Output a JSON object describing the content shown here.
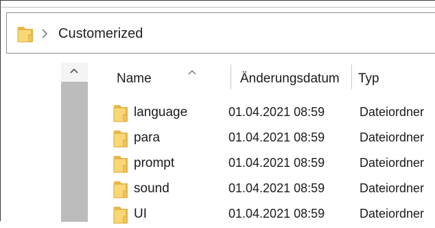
{
  "address_bar": {
    "path": "Customerized",
    "folder_icon": "folder-icon",
    "separator_icon": "chevron-right-icon"
  },
  "columns": {
    "name": "Name",
    "date": "Änderungsdatum",
    "type": "Typ",
    "sort_icon": "sort-ascending-icon"
  },
  "nav_pane": {
    "scroll_icon": "chevron-up-icon"
  },
  "colors": {
    "folder_fill": "#f8d775",
    "folder_tab": "#e8b84a",
    "nav_pane": "#bcbcbc"
  },
  "files": [
    {
      "name": "language",
      "date": "01.04.2021 08:59",
      "type": "Dateiordner"
    },
    {
      "name": "para",
      "date": "01.04.2021 08:59",
      "type": "Dateiordner"
    },
    {
      "name": "prompt",
      "date": "01.04.2021 08:59",
      "type": "Dateiordner"
    },
    {
      "name": "sound",
      "date": "01.04.2021 08:59",
      "type": "Dateiordner"
    },
    {
      "name": "UI",
      "date": "01.04.2021 08:59",
      "type": "Dateiordner"
    }
  ]
}
